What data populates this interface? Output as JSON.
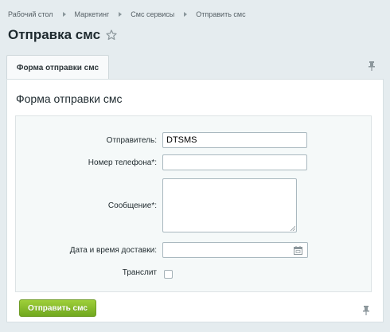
{
  "breadcrumb": [
    "Рабочий стол",
    "Маркетинг",
    "Смс сервисы",
    "Отправить смс"
  ],
  "page": {
    "title": "Отправка смс"
  },
  "tabs": [
    {
      "label": "Форма отправки смс"
    }
  ],
  "card": {
    "title": "Форма отправки смс"
  },
  "form": {
    "sender_label": "Отправитель:",
    "sender_value": "DTSMS",
    "phone_label": "Номер телефона*:",
    "phone_value": "",
    "message_label": "Сообщение*:",
    "datetime_label": "Дата и время доставки:",
    "datetime_value": "",
    "translit_label": "Транслит",
    "translit_checked": false
  },
  "actions": {
    "submit_label": "Отправить смс"
  },
  "icons": {
    "favorite": "star-icon",
    "pin": "pin-icon",
    "calendar": "calendar-icon"
  },
  "colors": {
    "accent": "#7fb82a",
    "background": "#e5ecef"
  }
}
